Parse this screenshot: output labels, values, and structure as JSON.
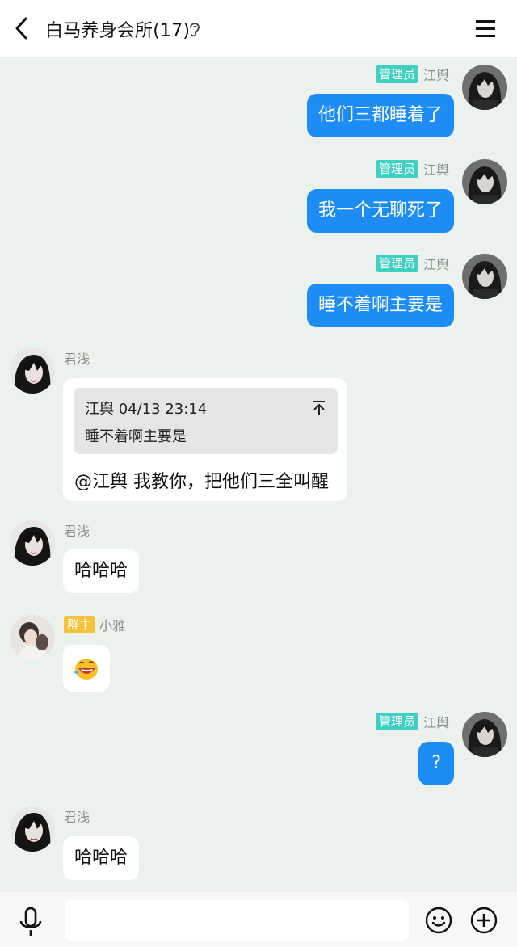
{
  "header": {
    "title": "白马养身会所(17)",
    "back_icon": "back-arrow-icon",
    "ear_icon": "ear-icon",
    "menu_icon": "menu-icon"
  },
  "colors": {
    "accent_blue": "#1e8cf5",
    "admin_badge": "#3fd0c1",
    "owner_badge": "#f7c23a",
    "chat_bg": "#edf1ee"
  },
  "messages": [
    {
      "side": "out",
      "badge": "管理员",
      "sender": "江舆",
      "text": "他们三都睡着了"
    },
    {
      "side": "out",
      "badge": "管理员",
      "sender": "江舆",
      "text": "我一个无聊死了"
    },
    {
      "side": "out",
      "badge": "管理员",
      "sender": "江舆",
      "text": "睡不着啊主要是"
    },
    {
      "side": "in",
      "sender": "君浅",
      "quote": {
        "sender": "江舆 04/13 23:14",
        "text": "睡不着啊主要是"
      },
      "text": "@江舆 我教你，把他们三全叫醒"
    },
    {
      "side": "in",
      "sender": "君浅",
      "text": "哈哈哈"
    },
    {
      "side": "in",
      "badge": "群主",
      "sender": "小雅",
      "emoji": "laughing-face-emoji"
    },
    {
      "side": "out",
      "badge": "管理员",
      "sender": "江舆",
      "text": "?"
    },
    {
      "side": "in",
      "sender": "君浅",
      "text": "哈哈哈"
    }
  ],
  "input": {
    "placeholder": "",
    "value": "",
    "mic_icon": "microphone-icon",
    "emoji_icon": "smiley-icon",
    "add_icon": "plus-circle-icon"
  }
}
